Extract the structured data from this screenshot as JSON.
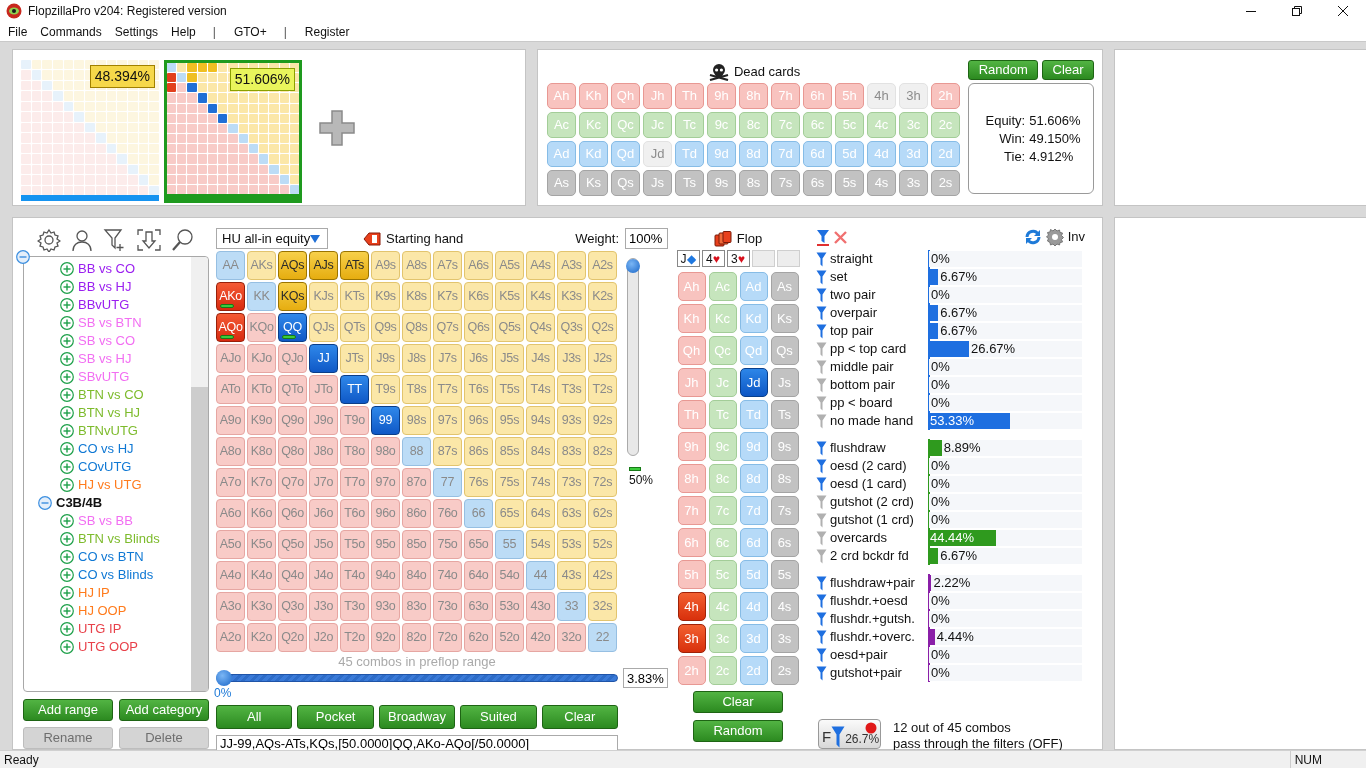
{
  "window": {
    "title": "FlopzillaPro v204: Registered version"
  },
  "menu": [
    {
      "label": "File",
      "kind": "item"
    },
    {
      "label": "Commands",
      "kind": "item"
    },
    {
      "label": "Settings",
      "kind": "item"
    },
    {
      "label": "Help",
      "kind": "item"
    },
    {
      "label": "|",
      "kind": "separator"
    },
    {
      "label": "GTO+",
      "kind": "item"
    },
    {
      "label": "|",
      "kind": "separator"
    },
    {
      "label": "Register",
      "kind": "item"
    }
  ],
  "players": [
    {
      "equity": "48.394%",
      "selected": false
    },
    {
      "equity": "51.606%",
      "selected": true
    }
  ],
  "dead_cards": {
    "title": "Dead cards",
    "buttons": [
      "Random",
      "Clear"
    ],
    "rows": [
      {
        "kind": "heart",
        "cards": [
          {
            "label": "Ah",
            "disabled": false
          },
          {
            "label": "Kh",
            "disabled": false
          },
          {
            "label": "Qh",
            "disabled": false
          },
          {
            "label": "Jh",
            "disabled": false
          },
          {
            "label": "Th",
            "disabled": false
          },
          {
            "label": "9h",
            "disabled": false
          },
          {
            "label": "8h",
            "disabled": false
          },
          {
            "label": "7h",
            "disabled": false
          },
          {
            "label": "6h",
            "disabled": false
          },
          {
            "label": "5h",
            "disabled": false
          },
          {
            "label": "4h",
            "disabled": true
          },
          {
            "label": "3h",
            "disabled": true
          },
          {
            "label": "2h",
            "disabled": false
          }
        ]
      },
      {
        "kind": "club",
        "cards": [
          {
            "label": "Ac",
            "disabled": false
          },
          {
            "label": "Kc",
            "disabled": false
          },
          {
            "label": "Qc",
            "disabled": false
          },
          {
            "label": "Jc",
            "disabled": false
          },
          {
            "label": "Tc",
            "disabled": false
          },
          {
            "label": "9c",
            "disabled": false
          },
          {
            "label": "8c",
            "disabled": false
          },
          {
            "label": "7c",
            "disabled": false
          },
          {
            "label": "6c",
            "disabled": false
          },
          {
            "label": "5c",
            "disabled": false
          },
          {
            "label": "4c",
            "disabled": false
          },
          {
            "label": "3c",
            "disabled": false
          },
          {
            "label": "2c",
            "disabled": false
          }
        ]
      },
      {
        "kind": "diamond",
        "cards": [
          {
            "label": "Ad",
            "disabled": false
          },
          {
            "label": "Kd",
            "disabled": false
          },
          {
            "label": "Qd",
            "disabled": false
          },
          {
            "label": "Jd",
            "disabled": true
          },
          {
            "label": "Td",
            "disabled": false
          },
          {
            "label": "9d",
            "disabled": false
          },
          {
            "label": "8d",
            "disabled": false
          },
          {
            "label": "7d",
            "disabled": false
          },
          {
            "label": "6d",
            "disabled": false
          },
          {
            "label": "5d",
            "disabled": false
          },
          {
            "label": "4d",
            "disabled": false
          },
          {
            "label": "3d",
            "disabled": false
          },
          {
            "label": "2d",
            "disabled": false
          }
        ]
      },
      {
        "kind": "spade",
        "cards": [
          {
            "label": "As",
            "disabled": false
          },
          {
            "label": "Ks",
            "disabled": false
          },
          {
            "label": "Qs",
            "disabled": false
          },
          {
            "label": "Js",
            "disabled": false
          },
          {
            "label": "Ts",
            "disabled": false
          },
          {
            "label": "9s",
            "disabled": false
          },
          {
            "label": "8s",
            "disabled": false
          },
          {
            "label": "7s",
            "disabled": false
          },
          {
            "label": "6s",
            "disabled": false
          },
          {
            "label": "5s",
            "disabled": false
          },
          {
            "label": "4s",
            "disabled": false
          },
          {
            "label": "3s",
            "disabled": false
          },
          {
            "label": "2s",
            "disabled": false
          }
        ]
      }
    ],
    "equity": [
      {
        "label": "Equity:",
        "value": "51.606%"
      },
      {
        "label": "Win:",
        "value": "49.150%"
      },
      {
        "label": "Tie:",
        "value": "4.912%"
      }
    ]
  },
  "tree": {
    "expanded": true,
    "children": [
      {
        "children": [
          {
            "label": "BB vs CO",
            "color": "#9a1ef0",
            "expanded": false
          },
          {
            "label": "BB vs HJ",
            "color": "#9a1ef0",
            "expanded": false
          },
          {
            "label": "BBvUTG",
            "color": "#9a1ef0",
            "expanded": false
          },
          {
            "label": "SB vs BTN",
            "color": "#f26ef2",
            "expanded": false
          },
          {
            "label": "SB vs CO",
            "color": "#f26ef2",
            "expanded": false
          },
          {
            "label": "SB vs HJ",
            "color": "#f26ef2",
            "expanded": false
          },
          {
            "label": "SBvUTG",
            "color": "#f26ef2",
            "expanded": false
          },
          {
            "label": "BTN vs CO",
            "color": "#7dbb2c",
            "expanded": false
          },
          {
            "label": "BTN vs HJ",
            "color": "#7dbb2c",
            "expanded": false
          },
          {
            "label": "BTNvUTG",
            "color": "#7dbb2c",
            "expanded": false
          },
          {
            "label": "CO vs HJ",
            "color": "#0f78d4",
            "expanded": false
          },
          {
            "label": "COvUTG",
            "color": "#0f78d4",
            "expanded": false
          },
          {
            "label": "HJ vs UTG",
            "color": "#ff7b1c",
            "expanded": false
          }
        ]
      },
      {
        "label": "C3B/4B",
        "expanded": true,
        "children": [
          {
            "label": "SB vs BB",
            "color": "#f26ef2",
            "expanded": false
          },
          {
            "label": "BTN vs Blinds",
            "color": "#7dbb2c",
            "expanded": false
          },
          {
            "label": "CO vs BTN",
            "color": "#0f78d4",
            "expanded": false
          },
          {
            "label": "CO vs Blinds",
            "color": "#0f78d4",
            "expanded": false
          },
          {
            "label": "HJ IP",
            "color": "#ff7b1c",
            "expanded": false
          },
          {
            "label": "HJ OOP",
            "color": "#ff7b1c",
            "expanded": false
          },
          {
            "label": "UTG IP",
            "color": "#e8414a",
            "expanded": false
          },
          {
            "label": "UTG OOP",
            "color": "#e8414a",
            "expanded": false
          }
        ]
      }
    ]
  },
  "tree_buttons": [
    {
      "label": "Add range",
      "disabled": false
    },
    {
      "label": "Add category",
      "disabled": false
    },
    {
      "label": "Rename",
      "disabled": true
    },
    {
      "label": "Delete",
      "disabled": true
    }
  ],
  "range_panel": {
    "mode": "HU all-in equity",
    "starting_hand": "Starting hand",
    "weight_label": "Weight:",
    "weight": "100%",
    "weight_slider": {
      "level": 1
    },
    "weight_note": "50%",
    "grid": [
      [
        {
          "label": "AA",
          "selected": false,
          "half": false
        },
        {
          "label": "AKs",
          "selected": false,
          "half": false
        },
        {
          "label": "AQs",
          "selected": true,
          "half": false
        },
        {
          "label": "AJs",
          "selected": true,
          "half": false
        },
        {
          "label": "ATs",
          "selected": true,
          "half": false
        },
        {
          "label": "A9s",
          "selected": false,
          "half": false
        },
        {
          "label": "A8s",
          "selected": false,
          "half": false
        },
        {
          "label": "A7s",
          "selected": false,
          "half": false
        },
        {
          "label": "A6s",
          "selected": false,
          "half": false
        },
        {
          "label": "A5s",
          "selected": false,
          "half": false
        },
        {
          "label": "A4s",
          "selected": false,
          "half": false
        },
        {
          "label": "A3s",
          "selected": false,
          "half": false
        },
        {
          "label": "A2s",
          "selected": false,
          "half": false
        }
      ],
      [
        {
          "label": "AKo",
          "selected": true,
          "half": true
        },
        {
          "label": "KK",
          "selected": false,
          "half": false
        },
        {
          "label": "KQs",
          "selected": true,
          "half": false
        },
        {
          "label": "KJs",
          "selected": false,
          "half": false
        },
        {
          "label": "KTs",
          "selected": false,
          "half": false
        },
        {
          "label": "K9s",
          "selected": false,
          "half": false
        },
        {
          "label": "K8s",
          "selected": false,
          "half": false
        },
        {
          "label": "K7s",
          "selected": false,
          "half": false
        },
        {
          "label": "K6s",
          "selected": false,
          "half": false
        },
        {
          "label": "K5s",
          "selected": false,
          "half": false
        },
        {
          "label": "K4s",
          "selected": false,
          "half": false
        },
        {
          "label": "K3s",
          "selected": false,
          "half": false
        },
        {
          "label": "K2s",
          "selected": false,
          "half": false
        }
      ],
      [
        {
          "label": "AQo",
          "selected": true,
          "half": true
        },
        {
          "label": "KQo",
          "selected": false,
          "half": false
        },
        {
          "label": "QQ",
          "selected": true,
          "half": true
        },
        {
          "label": "QJs",
          "selected": false,
          "half": false
        },
        {
          "label": "QTs",
          "selected": false,
          "half": false
        },
        {
          "label": "Q9s",
          "selected": false,
          "half": false
        },
        {
          "label": "Q8s",
          "selected": false,
          "half": false
        },
        {
          "label": "Q7s",
          "selected": false,
          "half": false
        },
        {
          "label": "Q6s",
          "selected": false,
          "half": false
        },
        {
          "label": "Q5s",
          "selected": false,
          "half": false
        },
        {
          "label": "Q4s",
          "selected": false,
          "half": false
        },
        {
          "label": "Q3s",
          "selected": false,
          "half": false
        },
        {
          "label": "Q2s",
          "selected": false,
          "half": false
        }
      ],
      [
        {
          "label": "AJo",
          "selected": false,
          "half": false
        },
        {
          "label": "KJo",
          "selected": false,
          "half": false
        },
        {
          "label": "QJo",
          "selected": false,
          "half": false
        },
        {
          "label": "JJ",
          "selected": true,
          "half": false
        },
        {
          "label": "JTs",
          "selected": false,
          "half": false
        },
        {
          "label": "J9s",
          "selected": false,
          "half": false
        },
        {
          "label": "J8s",
          "selected": false,
          "half": false
        },
        {
          "label": "J7s",
          "selected": false,
          "half": false
        },
        {
          "label": "J6s",
          "selected": false,
          "half": false
        },
        {
          "label": "J5s",
          "selected": false,
          "half": false
        },
        {
          "label": "J4s",
          "selected": false,
          "half": false
        },
        {
          "label": "J3s",
          "selected": false,
          "half": false
        },
        {
          "label": "J2s",
          "selected": false,
          "half": false
        }
      ],
      [
        {
          "label": "ATo",
          "selected": false,
          "half": false
        },
        {
          "label": "KTo",
          "selected": false,
          "half": false
        },
        {
          "label": "QTo",
          "selected": false,
          "half": false
        },
        {
          "label": "JTo",
          "selected": false,
          "half": false
        },
        {
          "label": "TT",
          "selected": true,
          "half": false
        },
        {
          "label": "T9s",
          "selected": false,
          "half": false
        },
        {
          "label": "T8s",
          "selected": false,
          "half": false
        },
        {
          "label": "T7s",
          "selected": false,
          "half": false
        },
        {
          "label": "T6s",
          "selected": false,
          "half": false
        },
        {
          "label": "T5s",
          "selected": false,
          "half": false
        },
        {
          "label": "T4s",
          "selected": false,
          "half": false
        },
        {
          "label": "T3s",
          "selected": false,
          "half": false
        },
        {
          "label": "T2s",
          "selected": false,
          "half": false
        }
      ],
      [
        {
          "label": "A9o",
          "selected": false,
          "half": false
        },
        {
          "label": "K9o",
          "selected": false,
          "half": false
        },
        {
          "label": "Q9o",
          "selected": false,
          "half": false
        },
        {
          "label": "J9o",
          "selected": false,
          "half": false
        },
        {
          "label": "T9o",
          "selected": false,
          "half": false
        },
        {
          "label": "99",
          "selected": true,
          "half": false
        },
        {
          "label": "98s",
          "selected": false,
          "half": false
        },
        {
          "label": "97s",
          "selected": false,
          "half": false
        },
        {
          "label": "96s",
          "selected": false,
          "half": false
        },
        {
          "label": "95s",
          "selected": false,
          "half": false
        },
        {
          "label": "94s",
          "selected": false,
          "half": false
        },
        {
          "label": "93s",
          "selected": false,
          "half": false
        },
        {
          "label": "92s",
          "selected": false,
          "half": false
        }
      ],
      [
        {
          "label": "A8o",
          "selected": false,
          "half": false
        },
        {
          "label": "K8o",
          "selected": false,
          "half": false
        },
        {
          "label": "Q8o",
          "selected": false,
          "half": false
        },
        {
          "label": "J8o",
          "selected": false,
          "half": false
        },
        {
          "label": "T8o",
          "selected": false,
          "half": false
        },
        {
          "label": "98o",
          "selected": false,
          "half": false
        },
        {
          "label": "88",
          "selected": false,
          "half": false
        },
        {
          "label": "87s",
          "selected": false,
          "half": false
        },
        {
          "label": "86s",
          "selected": false,
          "half": false
        },
        {
          "label": "85s",
          "selected": false,
          "half": false
        },
        {
          "label": "84s",
          "selected": false,
          "half": false
        },
        {
          "label": "83s",
          "selected": false,
          "half": false
        },
        {
          "label": "82s",
          "selected": false,
          "half": false
        }
      ],
      [
        {
          "label": "A7o",
          "selected": false,
          "half": false
        },
        {
          "label": "K7o",
          "selected": false,
          "half": false
        },
        {
          "label": "Q7o",
          "selected": false,
          "half": false
        },
        {
          "label": "J7o",
          "selected": false,
          "half": false
        },
        {
          "label": "T7o",
          "selected": false,
          "half": false
        },
        {
          "label": "97o",
          "selected": false,
          "half": false
        },
        {
          "label": "87o",
          "selected": false,
          "half": false
        },
        {
          "label": "77",
          "selected": false,
          "half": false
        },
        {
          "label": "76s",
          "selected": false,
          "half": false
        },
        {
          "label": "75s",
          "selected": false,
          "half": false
        },
        {
          "label": "74s",
          "selected": false,
          "half": false
        },
        {
          "label": "73s",
          "selected": false,
          "half": false
        },
        {
          "label": "72s",
          "selected": false,
          "half": false
        }
      ],
      [
        {
          "label": "A6o",
          "selected": false,
          "half": false
        },
        {
          "label": "K6o",
          "selected": false,
          "half": false
        },
        {
          "label": "Q6o",
          "selected": false,
          "half": false
        },
        {
          "label": "J6o",
          "selected": false,
          "half": false
        },
        {
          "label": "T6o",
          "selected": false,
          "half": false
        },
        {
          "label": "96o",
          "selected": false,
          "half": false
        },
        {
          "label": "86o",
          "selected": false,
          "half": false
        },
        {
          "label": "76o",
          "selected": false,
          "half": false
        },
        {
          "label": "66",
          "selected": false,
          "half": false
        },
        {
          "label": "65s",
          "selected": false,
          "half": false
        },
        {
          "label": "64s",
          "selected": false,
          "half": false
        },
        {
          "label": "63s",
          "selected": false,
          "half": false
        },
        {
          "label": "62s",
          "selected": false,
          "half": false
        }
      ],
      [
        {
          "label": "A5o",
          "selected": false,
          "half": false
        },
        {
          "label": "K5o",
          "selected": false,
          "half": false
        },
        {
          "label": "Q5o",
          "selected": false,
          "half": false
        },
        {
          "label": "J5o",
          "selected": false,
          "half": false
        },
        {
          "label": "T5o",
          "selected": false,
          "half": false
        },
        {
          "label": "95o",
          "selected": false,
          "half": false
        },
        {
          "label": "85o",
          "selected": false,
          "half": false
        },
        {
          "label": "75o",
          "selected": false,
          "half": false
        },
        {
          "label": "65o",
          "selected": false,
          "half": false
        },
        {
          "label": "55",
          "selected": false,
          "half": false
        },
        {
          "label": "54s",
          "selected": false,
          "half": false
        },
        {
          "label": "53s",
          "selected": false,
          "half": false
        },
        {
          "label": "52s",
          "selected": false,
          "half": false
        }
      ],
      [
        {
          "label": "A4o",
          "selected": false,
          "half": false
        },
        {
          "label": "K4o",
          "selected": false,
          "half": false
        },
        {
          "label": "Q4o",
          "selected": false,
          "half": false
        },
        {
          "label": "J4o",
          "selected": false,
          "half": false
        },
        {
          "label": "T4o",
          "selected": false,
          "half": false
        },
        {
          "label": "94o",
          "selected": false,
          "half": false
        },
        {
          "label": "84o",
          "selected": false,
          "half": false
        },
        {
          "label": "74o",
          "selected": false,
          "half": false
        },
        {
          "label": "64o",
          "selected": false,
          "half": false
        },
        {
          "label": "54o",
          "selected": false,
          "half": false
        },
        {
          "label": "44",
          "selected": false,
          "half": false
        },
        {
          "label": "43s",
          "selected": false,
          "half": false
        },
        {
          "label": "42s",
          "selected": false,
          "half": false
        }
      ],
      [
        {
          "label": "A3o",
          "selected": false,
          "half": false
        },
        {
          "label": "K3o",
          "selected": false,
          "half": false
        },
        {
          "label": "Q3o",
          "selected": false,
          "half": false
        },
        {
          "label": "J3o",
          "selected": false,
          "half": false
        },
        {
          "label": "T3o",
          "selected": false,
          "half": false
        },
        {
          "label": "93o",
          "selected": false,
          "half": false
        },
        {
          "label": "83o",
          "selected": false,
          "half": false
        },
        {
          "label": "73o",
          "selected": false,
          "half": false
        },
        {
          "label": "63o",
          "selected": false,
          "half": false
        },
        {
          "label": "53o",
          "selected": false,
          "half": false
        },
        {
          "label": "43o",
          "selected": false,
          "half": false
        },
        {
          "label": "33",
          "selected": false,
          "half": false
        },
        {
          "label": "32s",
          "selected": false,
          "half": false
        }
      ],
      [
        {
          "label": "A2o",
          "selected": false,
          "half": false
        },
        {
          "label": "K2o",
          "selected": false,
          "half": false
        },
        {
          "label": "Q2o",
          "selected": false,
          "half": false
        },
        {
          "label": "J2o",
          "selected": false,
          "half": false
        },
        {
          "label": "T2o",
          "selected": false,
          "half": false
        },
        {
          "label": "92o",
          "selected": false,
          "half": false
        },
        {
          "label": "82o",
          "selected": false,
          "half": false
        },
        {
          "label": "72o",
          "selected": false,
          "half": false
        },
        {
          "label": "62o",
          "selected": false,
          "half": false
        },
        {
          "label": "52o",
          "selected": false,
          "half": false
        },
        {
          "label": "42o",
          "selected": false,
          "half": false
        },
        {
          "label": "32o",
          "selected": false,
          "half": false
        },
        {
          "label": "22",
          "selected": false,
          "half": false
        }
      ]
    ],
    "combos": "45 combos in preflop range",
    "range_slider": {
      "level": 0
    },
    "slider_min": "0%",
    "slider_value": "3.83%",
    "buttons": [
      "All",
      "Pocket",
      "Broadway",
      "Suited",
      "Clear"
    ],
    "range_text": "JJ-99,AQs-ATs,KQs,[50.0000]QQ,AKo-AQo[/50.0000]"
  },
  "flop": {
    "title": "Flop",
    "board": [
      {
        "rank": "J",
        "suit": "◆",
        "kind": "diamond"
      },
      {
        "rank": "4",
        "suit": "♥",
        "kind": "heart"
      },
      {
        "rank": "3",
        "suit": "♥",
        "kind": "heart"
      },
      {
        "kind": "empty"
      },
      {
        "kind": "empty"
      }
    ],
    "columns": [
      {
        "kind": "heart",
        "cards": [
          {
            "label": "Ah",
            "selected": false
          },
          {
            "label": "Kh",
            "selected": false
          },
          {
            "label": "Qh",
            "selected": false
          },
          {
            "label": "Jh",
            "selected": false
          },
          {
            "label": "Th",
            "selected": false
          },
          {
            "label": "9h",
            "selected": false
          },
          {
            "label": "8h",
            "selected": false
          },
          {
            "label": "7h",
            "selected": false
          },
          {
            "label": "6h",
            "selected": false
          },
          {
            "label": "5h",
            "selected": false
          },
          {
            "label": "4h",
            "selected": true
          },
          {
            "label": "3h",
            "selected": true
          },
          {
            "label": "2h",
            "selected": false
          }
        ]
      },
      {
        "kind": "club",
        "cards": [
          {
            "label": "Ac",
            "selected": false
          },
          {
            "label": "Kc",
            "selected": false
          },
          {
            "label": "Qc",
            "selected": false
          },
          {
            "label": "Jc",
            "selected": false
          },
          {
            "label": "Tc",
            "selected": false
          },
          {
            "label": "9c",
            "selected": false
          },
          {
            "label": "8c",
            "selected": false
          },
          {
            "label": "7c",
            "selected": false
          },
          {
            "label": "6c",
            "selected": false
          },
          {
            "label": "5c",
            "selected": false
          },
          {
            "label": "4c",
            "selected": false
          },
          {
            "label": "3c",
            "selected": false
          },
          {
            "label": "2c",
            "selected": false
          }
        ]
      },
      {
        "kind": "diamond",
        "cards": [
          {
            "label": "Ad",
            "selected": false
          },
          {
            "label": "Kd",
            "selected": false
          },
          {
            "label": "Qd",
            "selected": false
          },
          {
            "label": "Jd",
            "selected": true
          },
          {
            "label": "Td",
            "selected": false
          },
          {
            "label": "9d",
            "selected": false
          },
          {
            "label": "8d",
            "selected": false
          },
          {
            "label": "7d",
            "selected": false
          },
          {
            "label": "6d",
            "selected": false
          },
          {
            "label": "5d",
            "selected": false
          },
          {
            "label": "4d",
            "selected": false
          },
          {
            "label": "3d",
            "selected": false
          },
          {
            "label": "2d",
            "selected": false
          }
        ]
      },
      {
        "kind": "spade",
        "cards": [
          {
            "label": "As",
            "selected": false
          },
          {
            "label": "Ks",
            "selected": false
          },
          {
            "label": "Qs",
            "selected": false
          },
          {
            "label": "Js",
            "selected": false
          },
          {
            "label": "Ts",
            "selected": false
          },
          {
            "label": "9s",
            "selected": false
          },
          {
            "label": "8s",
            "selected": false
          },
          {
            "label": "7s",
            "selected": false
          },
          {
            "label": "6s",
            "selected": false
          },
          {
            "label": "5s",
            "selected": false
          },
          {
            "label": "4s",
            "selected": false
          },
          {
            "label": "3s",
            "selected": false
          },
          {
            "label": "2s",
            "selected": false
          }
        ]
      }
    ],
    "buttons": [
      "Clear",
      "Random"
    ]
  },
  "stats": {
    "invert": "Inv",
    "groups": [
      {
        "color": "#1e6fe0",
        "rows": [
          {
            "label": "straight",
            "value": "0%",
            "level": 0,
            "active": true
          },
          {
            "label": "set",
            "value": "6.67%",
            "level": 0.0667,
            "active": true
          },
          {
            "label": "two pair",
            "value": "0%",
            "level": 0,
            "active": true
          },
          {
            "label": "overpair",
            "value": "6.67%",
            "level": 0.0667,
            "active": true
          },
          {
            "label": "top pair",
            "value": "6.67%",
            "level": 0.0667,
            "active": true
          },
          {
            "label": "pp < top card",
            "value": "26.67%",
            "level": 0.2667,
            "active": false
          },
          {
            "label": "middle pair",
            "value": "0%",
            "level": 0,
            "active": false
          },
          {
            "label": "bottom pair",
            "value": "0%",
            "level": 0,
            "active": false
          },
          {
            "label": "pp < board",
            "value": "0%",
            "level": 0,
            "active": false
          },
          {
            "label": "no made hand",
            "value": "53.33%",
            "level": 0.5333,
            "active": false
          }
        ]
      },
      {
        "color": "#2f9a1e",
        "rows": [
          {
            "label": "flushdraw",
            "value": "8.89%",
            "level": 0.0889,
            "active": true
          },
          {
            "label": "oesd (2 card)",
            "value": "0%",
            "level": 0,
            "active": true
          },
          {
            "label": "oesd (1 card)",
            "value": "0%",
            "level": 0,
            "active": true
          },
          {
            "label": "gutshot (2 crd)",
            "value": "0%",
            "level": 0,
            "active": false
          },
          {
            "label": "gutshot (1 crd)",
            "value": "0%",
            "level": 0,
            "active": false
          },
          {
            "label": "overcards",
            "value": "44.44%",
            "level": 0.4444,
            "active": false
          },
          {
            "label": "2 crd bckdr fd",
            "value": "6.67%",
            "level": 0.0667,
            "active": false
          }
        ]
      },
      {
        "color": "#8a1fa8",
        "rows": [
          {
            "label": "flushdraw+pair",
            "value": "2.22%",
            "level": 0.0222,
            "active": true
          },
          {
            "label": "flushdr.+oesd",
            "value": "0%",
            "level": 0,
            "active": true
          },
          {
            "label": "flushdr.+gutsh.",
            "value": "0%",
            "level": 0,
            "active": true
          },
          {
            "label": "flushdr.+overc.",
            "value": "4.44%",
            "level": 0.0444,
            "active": true
          },
          {
            "label": "oesd+pair",
            "value": "0%",
            "level": 0,
            "active": true
          },
          {
            "label": "gutshot+pair",
            "value": "0%",
            "level": 0,
            "active": true
          }
        ]
      }
    ],
    "filter_button": {
      "letter": "F",
      "percent": "26.7%"
    },
    "summary": [
      "12 out of 45 combos",
      "pass through the filters (OFF)"
    ]
  },
  "status_bar": {
    "left": "Ready",
    "right": "NUM"
  }
}
